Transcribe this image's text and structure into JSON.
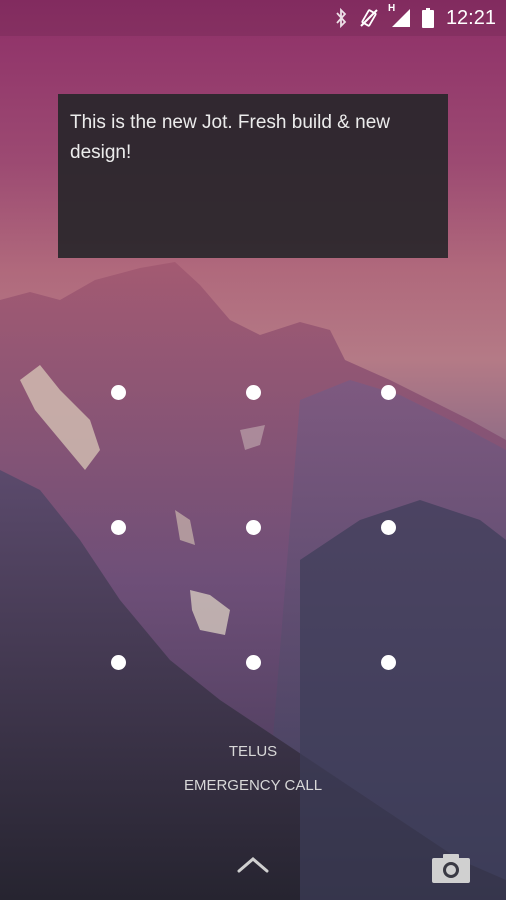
{
  "status_bar": {
    "icons": [
      "bluetooth-icon",
      "vibrate-icon",
      "signal-icon",
      "battery-icon"
    ],
    "network_label": "H",
    "time": "12:21"
  },
  "note_widget": {
    "text": "This is the new Jot. Fresh build & new design!"
  },
  "lock_screen": {
    "pattern_dots": 9,
    "carrier": "TELUS",
    "emergency_label": "EMERGENCY CALL",
    "icons": [
      "chevron-up-icon",
      "camera-icon"
    ]
  }
}
